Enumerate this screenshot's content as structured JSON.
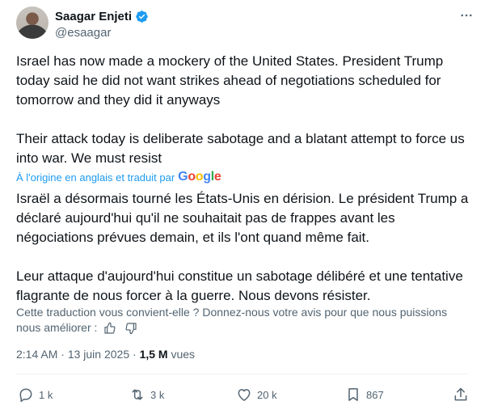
{
  "author": {
    "name": "Saagar Enjeti",
    "handle": "@esaagar"
  },
  "tweet": {
    "original_paragraphs": [
      "Israel has now made a mockery of the United States. President Trump today said he did not want strikes ahead of negotiations scheduled for tomorrow and they did it anyways",
      "Their attack today is deliberate sabotage and a blatant attempt to force us into war. We must resist"
    ],
    "translated_from": "À l'origine en anglais et traduit par",
    "translator": "Google",
    "translated_paragraphs": [
      "Israël a désormais tourné les États-Unis en dérision. Le président Trump a déclaré aujourd'hui qu'il ne souhaitait pas de frappes avant les négociations prévues demain, et ils l'ont quand même fait.",
      "Leur attaque d'aujourd'hui constitue un sabotage délibéré et une tentative flagrante de nous forcer à la guerre. Nous devons résister."
    ],
    "feedback_prompt": "Cette traduction vous convient-elle ? Donnez-nous votre avis pour que nous puissions nous améliorer :",
    "time": "2:14 AM",
    "separator": "·",
    "date": "13 juin 2025",
    "views_count": "1,5 M",
    "views_label": "vues"
  },
  "actions": {
    "replies": "1 k",
    "reposts": "3 k",
    "likes": "20 k",
    "bookmarks": "867"
  },
  "colors": {
    "link": "#1d9bf0",
    "muted": "#536471",
    "text": "#0f1419",
    "verified": "#1d9bf0"
  },
  "icons": [
    "verified-badge-icon",
    "more-icon",
    "thumbs-up-icon",
    "thumbs-down-icon",
    "reply-icon",
    "repost-icon",
    "like-icon",
    "bookmark-icon",
    "share-icon"
  ]
}
